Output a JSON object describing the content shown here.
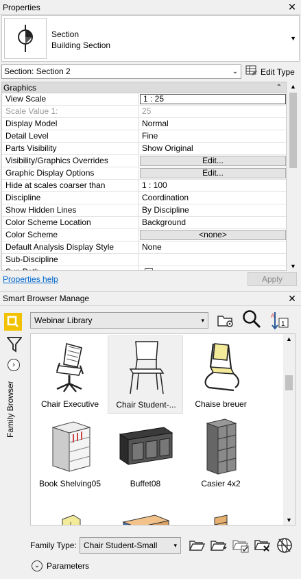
{
  "properties": {
    "title": "Properties",
    "type_selector": {
      "line1": "Section",
      "line2": "Building Section",
      "icon": "section-head-icon"
    },
    "instance_filter": "Section: Section 2",
    "edit_type_label": "Edit Type",
    "group": "Graphics",
    "rows": [
      {
        "name": "View Scale",
        "value": "1 : 25",
        "style": "boxed",
        "disabled": false
      },
      {
        "name": "Scale Value    1:",
        "value": "25",
        "style": "plain",
        "disabled": true
      },
      {
        "name": "Display Model",
        "value": "Normal",
        "style": "plain",
        "disabled": false
      },
      {
        "name": "Detail Level",
        "value": "Fine",
        "style": "plain",
        "disabled": false
      },
      {
        "name": "Parts Visibility",
        "value": "Show Original",
        "style": "plain",
        "disabled": false
      },
      {
        "name": "Visibility/Graphics Overrides",
        "value": "Edit...",
        "style": "button",
        "disabled": false
      },
      {
        "name": "Graphic Display Options",
        "value": "Edit...",
        "style": "button",
        "disabled": false
      },
      {
        "name": "Hide at scales coarser than",
        "value": "1 : 100",
        "style": "plain",
        "disabled": false
      },
      {
        "name": "Discipline",
        "value": "Coordination",
        "style": "plain",
        "disabled": false
      },
      {
        "name": "Show Hidden Lines",
        "value": "By Discipline",
        "style": "plain",
        "disabled": false
      },
      {
        "name": "Color Scheme Location",
        "value": "Background",
        "style": "plain",
        "disabled": false
      },
      {
        "name": "Color Scheme",
        "value": "<none>",
        "style": "button",
        "disabled": false
      },
      {
        "name": "Default Analysis Display Style",
        "value": "None",
        "style": "plain",
        "disabled": false
      },
      {
        "name": "Sub-Discipline",
        "value": "",
        "style": "plain",
        "disabled": false
      },
      {
        "name": "Sun Path",
        "value": "",
        "style": "checkbox",
        "disabled": false
      }
    ],
    "help_link": "Properties help",
    "apply_label": "Apply"
  },
  "smart_browser": {
    "title": "Smart Browser Manage",
    "side_label": "Family Browser",
    "library": "Webinar Library",
    "items": [
      {
        "label": "Chair Executive",
        "icon": "chair-executive-icon",
        "selected": false
      },
      {
        "label": "Chair Student-...",
        "icon": "chair-student-icon",
        "selected": true
      },
      {
        "label": "Chaise breuer",
        "icon": "chaise-breuer-icon",
        "selected": false
      },
      {
        "label": "Book Shelving05",
        "icon": "book-shelving-icon",
        "selected": false
      },
      {
        "label": "Buffet08",
        "icon": "buffet-icon",
        "selected": false
      },
      {
        "label": "Casier 4x2",
        "icon": "casier-icon",
        "selected": false
      },
      {
        "label": "",
        "icon": "cabinet-partial-icon",
        "selected": false
      },
      {
        "label": "",
        "icon": "desk-partial-icon",
        "selected": false
      },
      {
        "label": "",
        "icon": "shelf-partial-icon",
        "selected": false
      }
    ],
    "family_type_label": "Family Type:",
    "family_type_value": "Chair Student-Small",
    "parameters_label": "Parameters"
  },
  "colors": {
    "accent_yellow": "#f2c200",
    "link_blue": "#0066cc",
    "panel_bg": "#f0f0f0"
  }
}
